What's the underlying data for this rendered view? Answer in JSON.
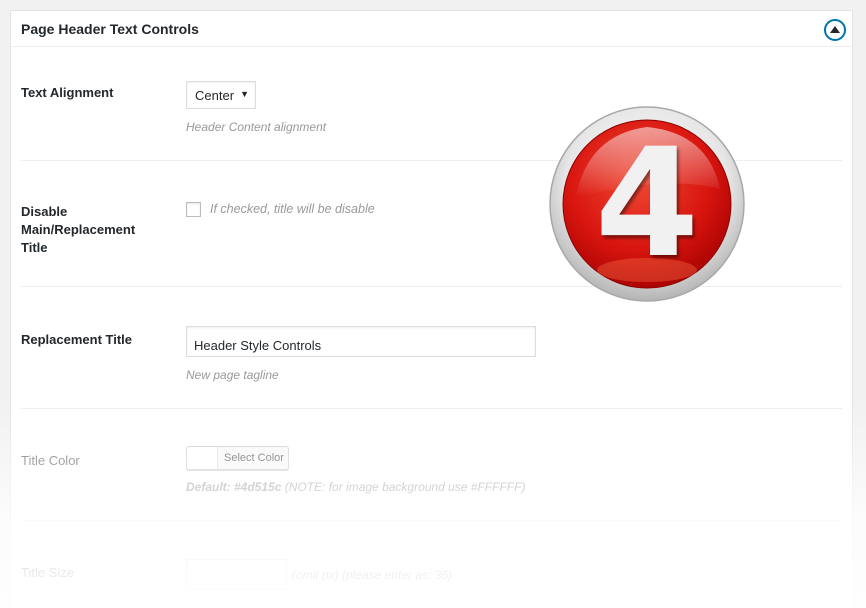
{
  "panel": {
    "title": "Page Header Text Controls",
    "toggle_icon": "triangle-up-icon"
  },
  "fields": {
    "text_alignment": {
      "label": "Text Alignment",
      "selected": "Center",
      "description": "Header Content alignment"
    },
    "disable_title": {
      "label": "Disable Main/Replacement Title",
      "checked": false,
      "description": "If checked, title will be disable"
    },
    "replacement_title": {
      "label": "Replacement Title",
      "value": "Header Style Controls",
      "description": "New page tagline"
    },
    "title_color": {
      "label": "Title Color",
      "button_label": "Select Color",
      "description_bold": "Default: #4d515c",
      "description_rest": " (NOTE: for image background use #FFFFFF)"
    },
    "title_size": {
      "label": "Title Size",
      "description": "(omit px) (please enter as: 36)"
    }
  },
  "badge": {
    "number": "4",
    "color": "#e0201a"
  },
  "colors": {
    "accent": "#0073aa",
    "text": "#23282d",
    "muted": "#999999"
  }
}
